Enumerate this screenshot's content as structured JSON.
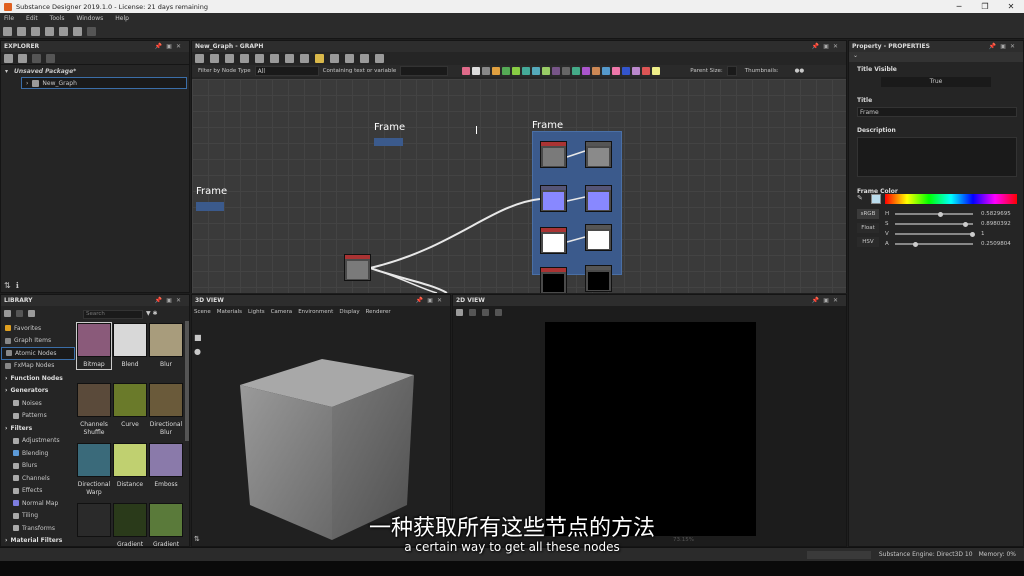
{
  "window": {
    "title": "Substance Designer 2019.1.0 - License: 21 days remaining"
  },
  "menu": [
    "File",
    "Edit",
    "Tools",
    "Windows",
    "Help"
  ],
  "explorer": {
    "title": "EXPLORER",
    "package": "Unsaved Package*",
    "graph": "New_Graph"
  },
  "graph": {
    "title": "New_Graph - GRAPH",
    "filter_label": "Filter by Node Type",
    "filter_value": "All",
    "containing_label": "Containing text or variable",
    "parent_size_label": "Parent Size:",
    "thumbnails_label": "Thumbnails:",
    "frames": [
      "Frame",
      "Frame",
      "Frame"
    ]
  },
  "properties": {
    "title": "Property - PROPERTIES",
    "title_visible_label": "Title Visible",
    "title_visible_value": "True",
    "title_label": "Title",
    "title_value": "Frame",
    "description_label": "Description",
    "frame_color_label": "Frame Color",
    "modes": [
      "sRGB",
      "Float",
      "HSV"
    ],
    "hsva": [
      {
        "k": "H",
        "v": "0.5829695",
        "f": 0.58
      },
      {
        "k": "S",
        "v": "0.8980392",
        "f": 0.9
      },
      {
        "k": "V",
        "v": "1",
        "f": 1.0
      },
      {
        "k": "A",
        "v": "0.2509804",
        "f": 0.25
      }
    ]
  },
  "library": {
    "title": "LIBRARY",
    "search_placeholder": "Search",
    "categories": [
      {
        "label": "Favorites",
        "bold": false,
        "color": "#e0a020"
      },
      {
        "label": "Graph Items",
        "bold": false,
        "color": "#888888"
      },
      {
        "label": "Atomic Nodes",
        "bold": false,
        "color": "#888888"
      },
      {
        "label": "FxMap Nodes",
        "bold": false,
        "color": "#888888"
      },
      {
        "label": "Function Nodes",
        "bold": true,
        "color": ""
      },
      {
        "label": "Generators",
        "bold": true,
        "color": ""
      },
      {
        "label": "Noises",
        "bold": false,
        "color": "#aaaaaa"
      },
      {
        "label": "Patterns",
        "bold": false,
        "color": "#aaaaaa"
      },
      {
        "label": "Filters",
        "bold": true,
        "color": ""
      },
      {
        "label": "Adjustments",
        "bold": false,
        "color": "#aaaaaa"
      },
      {
        "label": "Blending",
        "bold": false,
        "color": "#5c9ad8"
      },
      {
        "label": "Blurs",
        "bold": false,
        "color": "#aaaaaa"
      },
      {
        "label": "Channels",
        "bold": false,
        "color": "#aaaaaa"
      },
      {
        "label": "Effects",
        "bold": false,
        "color": "#aaaaaa"
      },
      {
        "label": "Normal Map",
        "bold": false,
        "color": "#7d7de0"
      },
      {
        "label": "Tiling",
        "bold": false,
        "color": "#aaaaaa"
      },
      {
        "label": "Transforms",
        "bold": false,
        "color": "#aaaaaa"
      },
      {
        "label": "Material Filters",
        "bold": true,
        "color": ""
      }
    ],
    "thumbs": [
      {
        "label": "Bitmap",
        "color": "#8a5a7a"
      },
      {
        "label": "Blend",
        "color": "#d8d8d8"
      },
      {
        "label": "Blur",
        "color": "#a89c7c"
      },
      {
        "label": "Channels Shuffle",
        "color": "#5a4a3a"
      },
      {
        "label": "Curve",
        "color": "#6a7a2a"
      },
      {
        "label": "Directional Blur",
        "color": "#6a5a3a"
      },
      {
        "label": "Directional Warp",
        "color": "#3a6a7a"
      },
      {
        "label": "Distance",
        "color": "#c0d070"
      },
      {
        "label": "Emboss",
        "color": "#8a7aaa"
      },
      {
        "label": "",
        "color": "#2a2a2a"
      },
      {
        "label": "Gradient",
        "color": "#2a3a1a"
      },
      {
        "label": "Gradient",
        "color": "#5a7a3a"
      }
    ]
  },
  "view3d": {
    "title": "3D VIEW",
    "menu": [
      "Scene",
      "Materials",
      "Lights",
      "Camera",
      "Environment",
      "Display",
      "Renderer"
    ]
  },
  "view2d": {
    "title": "2D VIEW",
    "zoom": "73.15%"
  },
  "status": {
    "engine": "Substance Engine: Direct3D 10",
    "memory": "Memory: 0%"
  },
  "subtitle": {
    "cn": "一种获取所有这些节点的方法",
    "en": "a certain way to get all these nodes"
  }
}
